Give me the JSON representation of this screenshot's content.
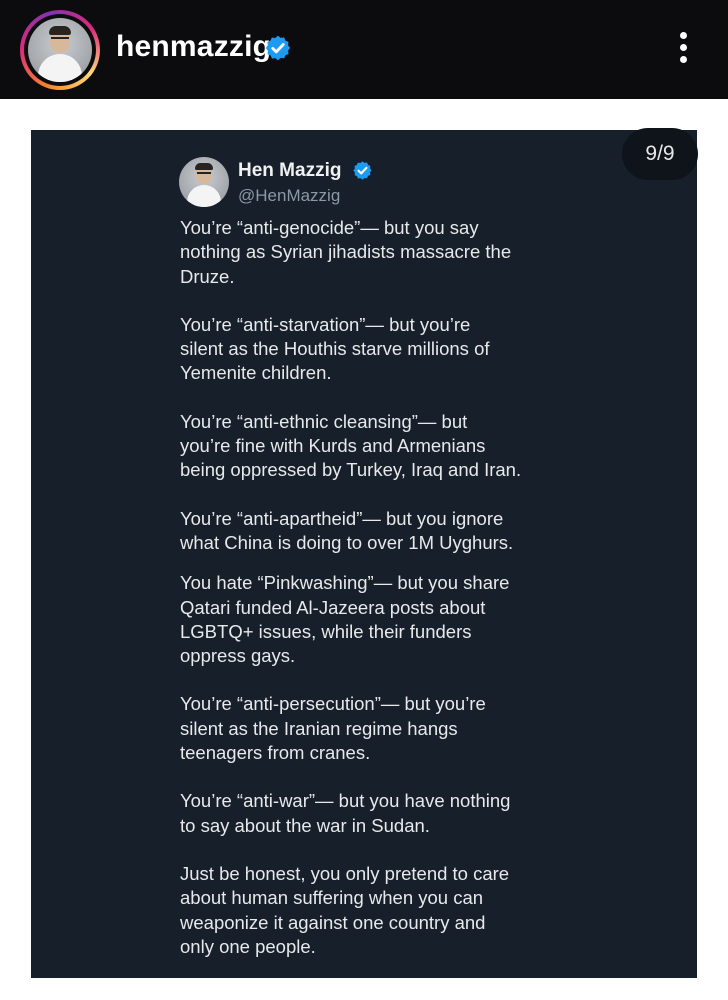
{
  "header": {
    "username": "henmazzig",
    "verified_icon": "verified-badge-icon",
    "more_icon": "more-vertical-icon"
  },
  "post": {
    "counter": "9/9",
    "tweet": {
      "name": "Hen Mazzig",
      "handle": "@HenMazzig",
      "paragraphs": [
        "You’re “anti-genocide”— but you say\nnothing as Syrian jihadists massacre the\nDruze.",
        "You’re “anti-starvation”— but you’re\nsilent as the Houthis starve millions of\nYemenite children.",
        "You’re “anti-ethnic cleansing”— but\nyou’re fine with Kurds and Armenians\nbeing oppressed by Turkey, Iraq and Iran.",
        "You’re “anti-apartheid”— but you ignore\nwhat China is doing to over 1M Uyghurs.",
        "You hate “Pinkwashing”— but you share\nQatari funded Al-Jazeera posts about\nLGBTQ+ issues, while their funders\noppress gays.",
        "You’re “anti-persecution”— but you’re\nsilent as the Iranian regime hangs\nteenagers from cranes.",
        "You’re “anti-war”— but you have nothing\nto say about the war in Sudan.",
        "Just be honest, you only pretend to care\nabout human suffering when you can\nweaponize it against one country and\nonly one people."
      ]
    }
  },
  "colors": {
    "header_bg": "#0c0c0f",
    "post_bg": "#161f2a",
    "verified_blue": "#1d9bf0",
    "tweet_text": "#e7e9ea",
    "handle_gray": "#8b98a5"
  }
}
